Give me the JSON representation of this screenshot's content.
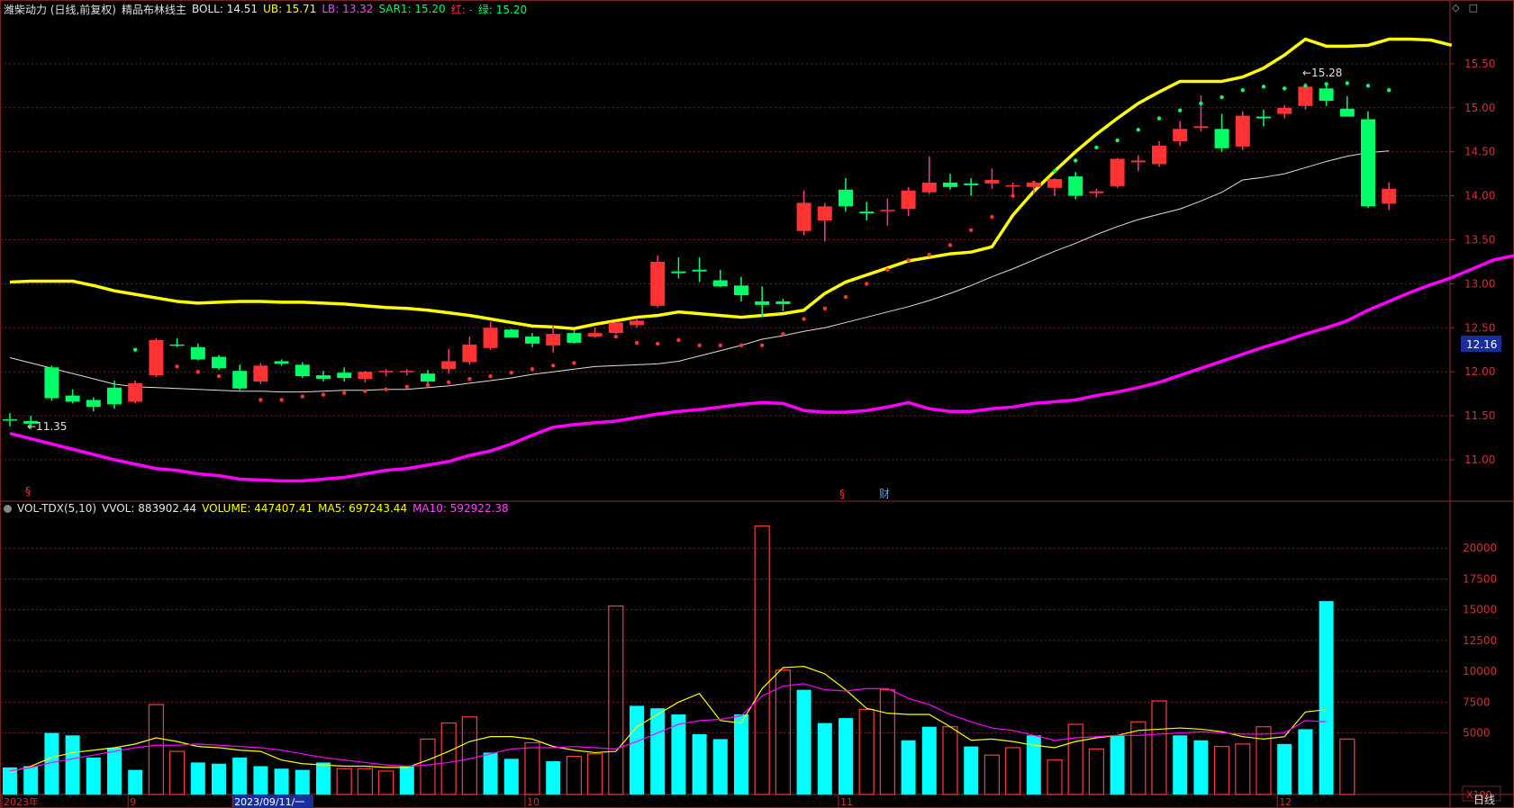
{
  "header": {
    "stock": "潍柴动力 (日线,前复权)",
    "indicator": "精品布林线主",
    "boll": "BOLL: 14.51",
    "ub": "UB: 15.71",
    "lb": "LB: 13.32",
    "sar": "SAR1: 15.20",
    "red": "红: -",
    "green": "绿: 15.20"
  },
  "vol_header": {
    "name": "VOL-TDX(5,10)",
    "vvol": "VVOL: 883902.44",
    "volume": "VOLUME: 447407.41",
    "ma5": "MA5: 697243.44",
    "ma10": "MA10: 592922.38"
  },
  "labels": {
    "current_price": "12.16",
    "low_mark": "←11.35",
    "high_mark": "←15.28",
    "event_s1": "§",
    "event_s2": "§",
    "event_cai": "财",
    "vol_unit": "X100",
    "period": "日线"
  },
  "colors": {
    "background": "#000000",
    "up": "#ff3333",
    "down": "#00ff66",
    "ub": "#ffff00",
    "lb": "#ff00ff",
    "mid": "#dddddd",
    "vol_up": "#ff3b3b",
    "vol_down": "#00ffff",
    "ma5": "#ffff00",
    "ma10": "#ff00ff",
    "grid": "#7a1f1f"
  },
  "chart_data": [
    {
      "type": "candlestick",
      "title": "潍柴动力 (日线,前复权)",
      "y_ticks": [
        "15.50",
        "15.00",
        "14.50",
        "14.00",
        "13.50",
        "13.00",
        "12.50",
        "12.00",
        "11.50",
        "11.00"
      ],
      "ylim": [
        10.55,
        16.0
      ],
      "x_ticks": [
        "2023年",
        "9",
        "2023/09/11/一",
        "10",
        "11",
        "12"
      ],
      "candles": [
        {
          "o": 11.46,
          "h": 11.53,
          "l": 11.38,
          "c": 11.45
        },
        {
          "o": 11.44,
          "h": 11.5,
          "l": 11.35,
          "c": 11.41
        },
        {
          "o": 12.05,
          "h": 12.07,
          "l": 11.67,
          "c": 11.7
        },
        {
          "o": 11.73,
          "h": 11.8,
          "l": 11.64,
          "c": 11.66
        },
        {
          "o": 11.68,
          "h": 11.71,
          "l": 11.55,
          "c": 11.6
        },
        {
          "o": 11.82,
          "h": 11.9,
          "l": 11.58,
          "c": 11.63
        },
        {
          "o": 11.66,
          "h": 11.9,
          "l": 11.64,
          "c": 11.87
        },
        {
          "o": 11.96,
          "h": 12.38,
          "l": 11.94,
          "c": 12.36
        },
        {
          "o": 12.31,
          "h": 12.38,
          "l": 12.28,
          "c": 12.3
        },
        {
          "o": 12.28,
          "h": 12.32,
          "l": 12.13,
          "c": 12.14
        },
        {
          "o": 12.17,
          "h": 12.19,
          "l": 12.02,
          "c": 12.04
        },
        {
          "o": 12.01,
          "h": 12.08,
          "l": 11.79,
          "c": 11.81
        },
        {
          "o": 11.89,
          "h": 12.1,
          "l": 11.86,
          "c": 12.07
        },
        {
          "o": 12.12,
          "h": 12.14,
          "l": 12.07,
          "c": 12.09
        },
        {
          "o": 12.08,
          "h": 12.11,
          "l": 11.93,
          "c": 11.95
        },
        {
          "o": 11.96,
          "h": 12.01,
          "l": 11.89,
          "c": 11.92
        },
        {
          "o": 11.99,
          "h": 12.05,
          "l": 11.89,
          "c": 11.93
        },
        {
          "o": 11.92,
          "h": 12.01,
          "l": 11.88,
          "c": 12.0
        },
        {
          "o": 12.0,
          "h": 12.03,
          "l": 11.95,
          "c": 12.01
        },
        {
          "o": 12.0,
          "h": 12.03,
          "l": 11.96,
          "c": 12.01
        },
        {
          "o": 11.98,
          "h": 12.02,
          "l": 11.87,
          "c": 11.89
        },
        {
          "o": 12.03,
          "h": 12.26,
          "l": 11.98,
          "c": 12.12
        },
        {
          "o": 12.11,
          "h": 12.4,
          "l": 12.08,
          "c": 12.31
        },
        {
          "o": 12.27,
          "h": 12.57,
          "l": 12.25,
          "c": 12.5
        },
        {
          "o": 12.48,
          "h": 12.49,
          "l": 12.39,
          "c": 12.39
        },
        {
          "o": 12.4,
          "h": 12.44,
          "l": 12.28,
          "c": 12.32
        },
        {
          "o": 12.3,
          "h": 12.53,
          "l": 12.22,
          "c": 12.43
        },
        {
          "o": 12.44,
          "h": 12.48,
          "l": 12.32,
          "c": 12.33
        },
        {
          "o": 12.4,
          "h": 12.5,
          "l": 12.39,
          "c": 12.44
        },
        {
          "o": 12.44,
          "h": 12.57,
          "l": 12.43,
          "c": 12.56
        },
        {
          "o": 12.53,
          "h": 12.6,
          "l": 12.5,
          "c": 12.58
        },
        {
          "o": 12.75,
          "h": 13.32,
          "l": 12.73,
          "c": 13.25
        },
        {
          "o": 13.14,
          "h": 13.3,
          "l": 13.06,
          "c": 13.12
        },
        {
          "o": 13.16,
          "h": 13.3,
          "l": 13.02,
          "c": 13.14
        },
        {
          "o": 13.04,
          "h": 13.16,
          "l": 12.96,
          "c": 12.97
        },
        {
          "o": 12.98,
          "h": 13.08,
          "l": 12.8,
          "c": 12.87
        },
        {
          "o": 12.8,
          "h": 12.97,
          "l": 12.62,
          "c": 12.76
        },
        {
          "o": 12.8,
          "h": 12.83,
          "l": 12.69,
          "c": 12.77
        },
        {
          "o": 13.6,
          "h": 14.06,
          "l": 13.55,
          "c": 13.92
        },
        {
          "o": 13.72,
          "h": 13.92,
          "l": 13.48,
          "c": 13.88
        },
        {
          "o": 14.07,
          "h": 14.2,
          "l": 13.82,
          "c": 13.88
        },
        {
          "o": 13.82,
          "h": 13.93,
          "l": 13.72,
          "c": 13.8
        },
        {
          "o": 13.84,
          "h": 13.97,
          "l": 13.66,
          "c": 13.84
        },
        {
          "o": 13.85,
          "h": 14.1,
          "l": 13.77,
          "c": 14.06
        },
        {
          "o": 14.04,
          "h": 14.45,
          "l": 14.02,
          "c": 14.15
        },
        {
          "o": 14.15,
          "h": 14.25,
          "l": 14.07,
          "c": 14.1
        },
        {
          "o": 14.14,
          "h": 14.2,
          "l": 14.0,
          "c": 14.12
        },
        {
          "o": 14.14,
          "h": 14.31,
          "l": 14.08,
          "c": 14.18
        },
        {
          "o": 14.12,
          "h": 14.15,
          "l": 13.98,
          "c": 14.12
        },
        {
          "o": 14.1,
          "h": 14.17,
          "l": 14.02,
          "c": 14.15
        },
        {
          "o": 14.09,
          "h": 14.2,
          "l": 14.0,
          "c": 14.19
        },
        {
          "o": 14.22,
          "h": 14.27,
          "l": 13.96,
          "c": 14.0
        },
        {
          "o": 14.03,
          "h": 14.08,
          "l": 13.98,
          "c": 14.05
        },
        {
          "o": 14.11,
          "h": 14.43,
          "l": 14.09,
          "c": 14.42
        },
        {
          "o": 14.38,
          "h": 14.46,
          "l": 14.28,
          "c": 14.4
        },
        {
          "o": 14.36,
          "h": 14.62,
          "l": 14.33,
          "c": 14.57
        },
        {
          "o": 14.62,
          "h": 14.85,
          "l": 14.57,
          "c": 14.76
        },
        {
          "o": 14.77,
          "h": 15.14,
          "l": 14.73,
          "c": 14.79
        },
        {
          "o": 14.76,
          "h": 14.93,
          "l": 14.5,
          "c": 14.54
        },
        {
          "o": 14.56,
          "h": 14.96,
          "l": 14.52,
          "c": 14.91
        },
        {
          "o": 14.9,
          "h": 14.98,
          "l": 14.79,
          "c": 14.88
        },
        {
          "o": 14.93,
          "h": 15.03,
          "l": 14.88,
          "c": 15.0
        },
        {
          "o": 15.02,
          "h": 15.28,
          "l": 14.98,
          "c": 15.24
        },
        {
          "o": 15.22,
          "h": 15.26,
          "l": 15.02,
          "c": 15.08
        },
        {
          "o": 14.99,
          "h": 15.13,
          "l": 14.91,
          "c": 14.9
        },
        {
          "o": 14.87,
          "h": 14.96,
          "l": 13.86,
          "c": 13.88
        },
        {
          "o": 13.91,
          "h": 14.15,
          "l": 13.84,
          "c": 14.08
        }
      ],
      "ub": [
        13.02,
        13.03,
        13.03,
        13.03,
        12.98,
        12.92,
        12.88,
        12.84,
        12.8,
        12.78,
        12.79,
        12.8,
        12.8,
        12.79,
        12.79,
        12.78,
        12.77,
        12.75,
        12.73,
        12.72,
        12.7,
        12.67,
        12.64,
        12.6,
        12.56,
        12.52,
        12.51,
        12.49,
        12.54,
        12.58,
        12.62,
        12.64,
        12.68,
        12.66,
        12.64,
        12.62,
        12.64,
        12.66,
        12.7,
        12.89,
        13.02,
        13.1,
        13.18,
        13.26,
        13.3,
        13.34,
        13.36,
        13.42,
        13.78,
        14.05,
        14.28,
        14.5,
        14.7,
        14.88,
        15.05,
        15.18,
        15.3,
        15.3,
        15.3,
        15.35,
        15.45,
        15.6,
        15.78,
        15.7,
        15.7,
        15.71,
        15.78,
        15.78,
        15.77,
        15.71
      ],
      "boll": [
        12.16,
        12.1,
        12.04,
        11.98,
        11.92,
        11.86,
        11.83,
        11.82,
        11.81,
        11.8,
        11.79,
        11.78,
        11.78,
        11.77,
        11.77,
        11.78,
        11.79,
        11.79,
        11.8,
        11.8,
        11.82,
        11.84,
        11.87,
        11.9,
        11.93,
        11.97,
        12.0,
        12.03,
        12.06,
        12.07,
        12.08,
        12.09,
        12.12,
        12.18,
        12.24,
        12.3,
        12.37,
        12.41,
        12.46,
        12.5,
        12.56,
        12.62,
        12.68,
        12.74,
        12.81,
        12.89,
        12.98,
        13.08,
        13.17,
        13.27,
        13.37,
        13.46,
        13.56,
        13.65,
        13.73,
        13.79,
        13.85,
        13.94,
        14.04,
        14.18,
        14.21,
        14.25,
        14.32,
        14.39,
        14.45,
        14.49,
        14.51
      ],
      "lb": [
        11.3,
        11.24,
        11.18,
        11.12,
        11.06,
        11.0,
        10.95,
        10.9,
        10.88,
        10.84,
        10.82,
        10.78,
        10.77,
        10.76,
        10.76,
        10.78,
        10.8,
        10.84,
        10.88,
        10.9,
        10.94,
        10.98,
        11.05,
        11.1,
        11.18,
        11.28,
        11.37,
        11.4,
        11.42,
        11.44,
        11.48,
        11.52,
        11.55,
        11.57,
        11.6,
        11.63,
        11.65,
        11.64,
        11.56,
        11.54,
        11.54,
        11.56,
        11.6,
        11.65,
        11.58,
        11.55,
        11.55,
        11.58,
        11.6,
        11.64,
        11.66,
        11.68,
        11.73,
        11.77,
        11.82,
        11.88,
        11.96,
        12.04,
        12.12,
        12.2,
        12.28,
        12.35,
        12.43,
        12.5,
        12.58,
        12.7,
        12.8,
        12.9,
        12.99,
        13.07,
        13.17,
        13.27,
        13.32
      ],
      "sar": [
        12.25,
        12.13,
        12.06,
        12.0,
        11.95,
        11.89,
        11.68,
        11.68,
        11.72,
        11.74,
        11.76,
        11.78,
        11.8,
        11.83,
        11.85,
        11.88,
        11.92,
        11.95,
        11.99,
        12.03,
        12.07,
        12.1,
        12.42,
        12.4,
        12.33,
        12.32,
        12.36,
        12.3,
        12.3,
        12.3,
        12.3,
        12.43,
        12.6,
        12.72,
        12.85,
        13.0,
        13.16,
        13.27,
        13.33,
        13.44,
        13.61,
        13.76,
        14.0,
        14.15,
        14.28,
        14.4,
        14.55,
        14.63,
        14.75,
        14.88,
        14.97,
        15.05,
        15.12,
        15.2,
        15.24,
        15.22,
        15.25,
        15.27,
        15.28,
        15.25,
        15.2
      ]
    },
    {
      "type": "bar",
      "title": "VOL-TDX(5,10)",
      "y_ticks": [
        "20000",
        "17500",
        "15000",
        "12500",
        "10000",
        "7500",
        "5000"
      ],
      "ylim": [
        0,
        22500
      ],
      "values": [
        2200,
        2300,
        5000,
        4800,
        3000,
        3800,
        2000,
        7300,
        3500,
        2600,
        2500,
        3000,
        2300,
        2100,
        2000,
        2600,
        2100,
        2100,
        1900,
        2300,
        4500,
        5800,
        6300,
        3400,
        2900,
        4200,
        2700,
        3100,
        3300,
        15300,
        7200,
        7000,
        6500,
        4900,
        4500,
        6500,
        21800,
        10100,
        8500,
        5800,
        6200,
        6900,
        8500,
        4400,
        5500,
        5500,
        3900,
        3200,
        3800,
        4800,
        2800,
        5700,
        3700,
        4800,
        5900,
        7600,
        4800,
        4400,
        3900,
        4100,
        5500,
        4100,
        5300,
        15700,
        4500
      ],
      "up_down": [
        "d",
        "d",
        "d",
        "d",
        "d",
        "d",
        "d",
        "u",
        "u",
        "d",
        "d",
        "d",
        "d",
        "d",
        "d",
        "d",
        "u",
        "u",
        "u",
        "d",
        "u",
        "u",
        "u",
        "d",
        "d",
        "u",
        "d",
        "u",
        "u",
        "u",
        "d",
        "d",
        "d",
        "d",
        "d",
        "d",
        "u",
        "u",
        "d",
        "d",
        "d",
        "u",
        "u",
        "d",
        "d",
        "u",
        "d",
        "u",
        "u",
        "d",
        "u",
        "u",
        "u",
        "d",
        "u",
        "u",
        "d",
        "d",
        "u",
        "u",
        "u",
        "d",
        "d",
        "d",
        "u"
      ],
      "ma5": [
        1800,
        2300,
        3000,
        3400,
        3600,
        3800,
        4100,
        4600,
        4300,
        3900,
        3800,
        3600,
        3500,
        2800,
        2500,
        2400,
        2300,
        2300,
        2200,
        2200,
        2800,
        3500,
        4300,
        4700,
        4700,
        4500,
        3900,
        3600,
        3400,
        3500,
        5500,
        6500,
        7500,
        8200,
        6000,
        5800,
        8600,
        10300,
        10400,
        9800,
        8500,
        7000,
        6600,
        6500,
        6500,
        5500,
        4400,
        4500,
        4300,
        4000,
        3800,
        4300,
        4600,
        4800,
        5200,
        5300,
        5400,
        5300,
        5100,
        4700,
        4500,
        4700,
        6700,
        6900
      ],
      "ma10": [
        1900,
        2200,
        2600,
        2900,
        3200,
        3500,
        3800,
        4000,
        4000,
        4100,
        4000,
        3900,
        3800,
        3600,
        3300,
        3000,
        2800,
        2600,
        2400,
        2300,
        2400,
        2600,
        2900,
        3300,
        3700,
        3800,
        3800,
        3900,
        3800,
        3700,
        4300,
        5000,
        5700,
        6000,
        6100,
        6400,
        8000,
        8800,
        9000,
        8500,
        8400,
        8600,
        8600,
        7800,
        7300,
        6500,
        5900,
        5400,
        5200,
        4800,
        4400,
        4600,
        4700,
        4800,
        4800,
        4900,
        5000,
        5100,
        5000,
        4900,
        4900,
        5000,
        6000,
        5900
      ]
    }
  ]
}
